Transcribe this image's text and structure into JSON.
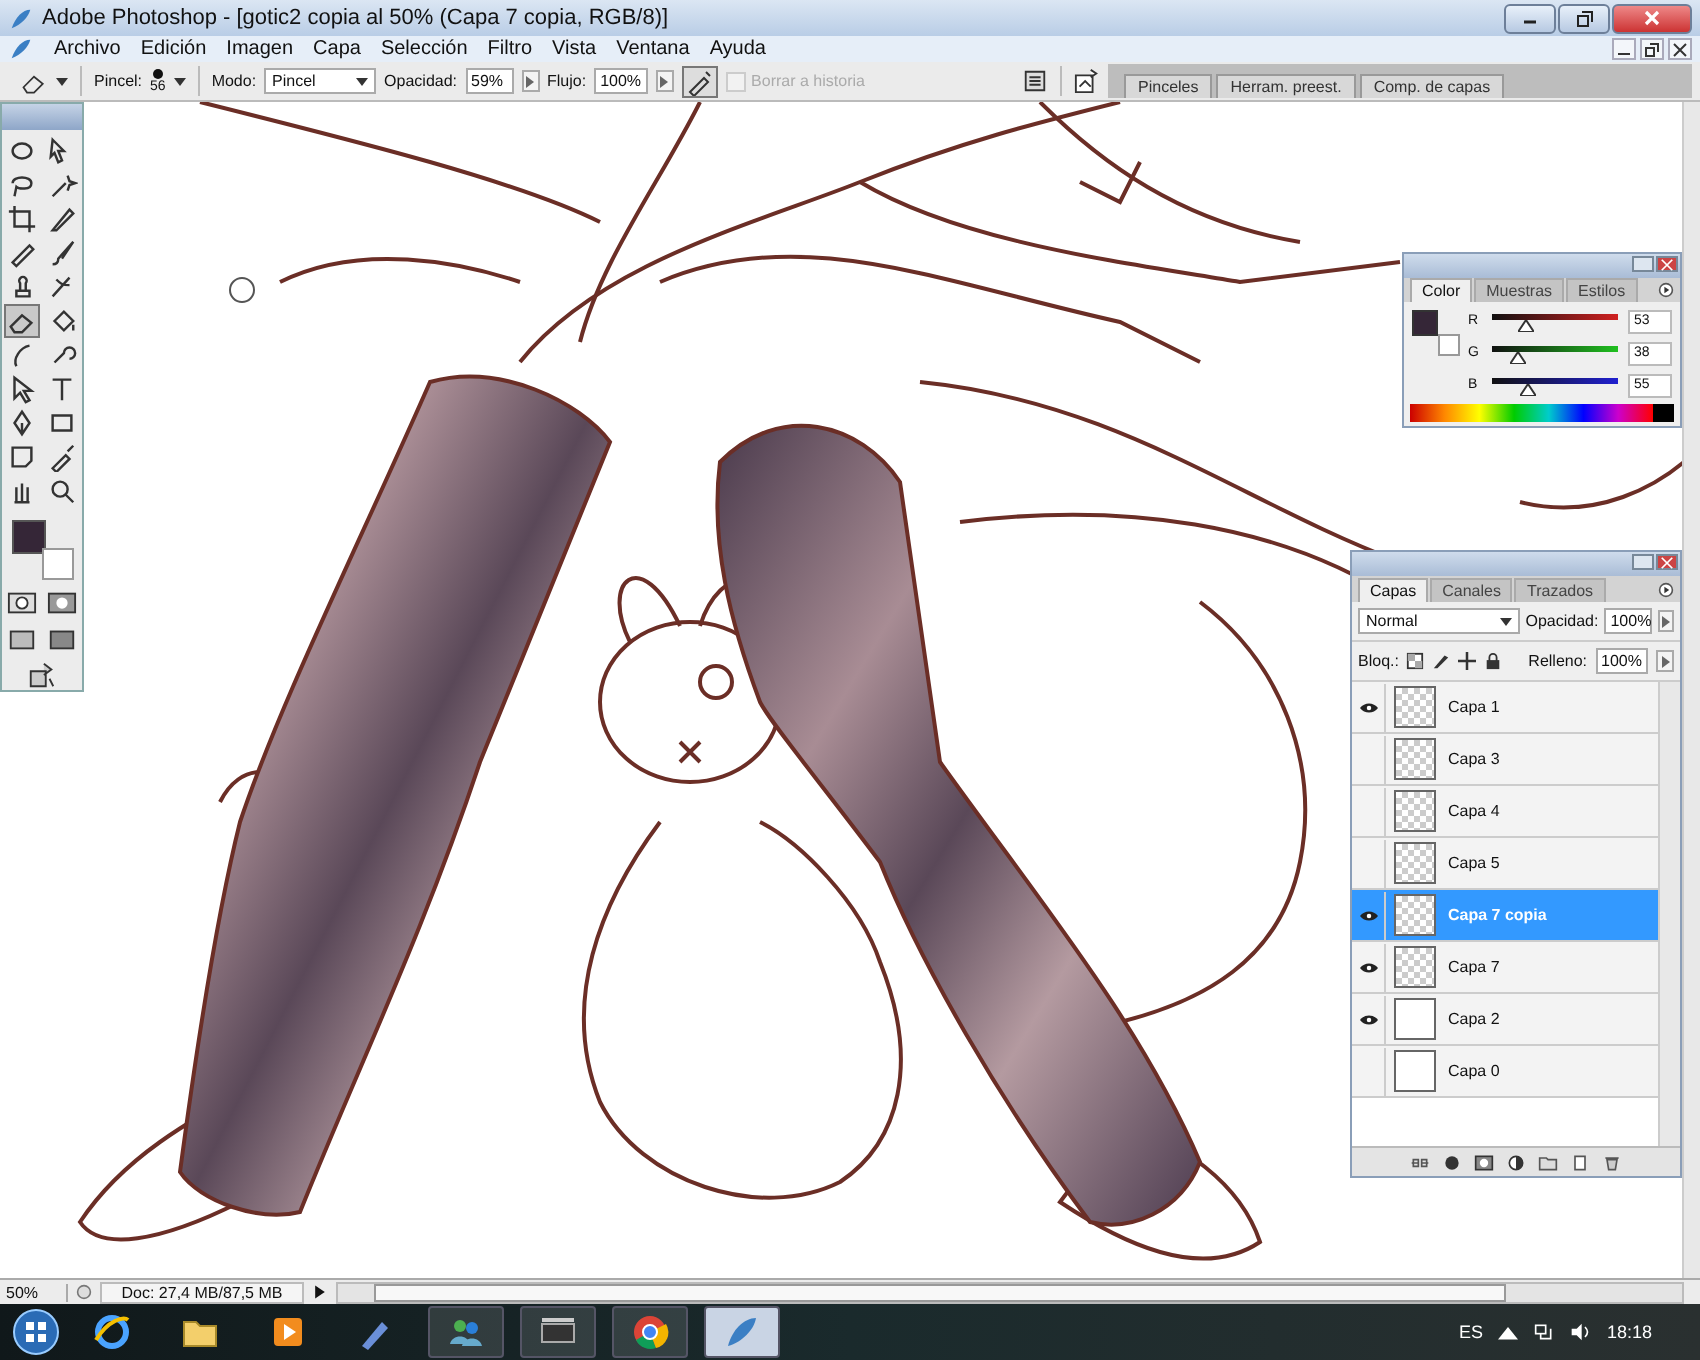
{
  "window": {
    "title": "Adobe Photoshop - [gotic2 copia al 50% (Capa 7 copia, RGB/8)]"
  },
  "menu": [
    "Archivo",
    "Edición",
    "Imagen",
    "Capa",
    "Selección",
    "Filtro",
    "Vista",
    "Ventana",
    "Ayuda"
  ],
  "options_bar": {
    "brush_label": "Pincel:",
    "brush_size": "56",
    "mode_label": "Modo:",
    "mode": "Pincel",
    "opacity_label": "Opacidad:",
    "opacity": "59%",
    "flow_label": "Flujo:",
    "flow": "100%",
    "erase_history": {
      "label": "Borrar a historia",
      "checked": false,
      "disabled": true
    }
  },
  "panel_well_tabs": [
    "Pinceles",
    "Herram. preest.",
    "Comp. de capas"
  ],
  "color_panel": {
    "tabs": [
      {
        "label": "Color",
        "selected": true
      },
      {
        "label": "Muestras",
        "selected": false
      },
      {
        "label": "Estilos",
        "selected": false
      }
    ],
    "channels": [
      {
        "name": "R",
        "value": "53",
        "level": 0.21
      },
      {
        "name": "G",
        "value": "38",
        "level": 0.15
      },
      {
        "name": "B",
        "value": "55",
        "level": 0.22
      }
    ]
  },
  "layers_panel": {
    "tabs": [
      {
        "label": "Capas",
        "selected": true
      },
      {
        "label": "Canales",
        "selected": false
      },
      {
        "label": "Trazados",
        "selected": false
      }
    ],
    "blend_mode": "Normal",
    "opacity_label": "Opacidad:",
    "opacity": "100%",
    "lock_label": "Bloq.:",
    "fill_label": "Relleno:",
    "fill": "100%",
    "layers": [
      {
        "name": "Capa 1",
        "visible": true,
        "selected": false,
        "kind": "transparent"
      },
      {
        "name": "Capa 3",
        "visible": false,
        "selected": false,
        "kind": "transparent"
      },
      {
        "name": "Capa 4",
        "visible": false,
        "selected": false,
        "kind": "transparent"
      },
      {
        "name": "Capa 5",
        "visible": false,
        "selected": false,
        "kind": "transparent"
      },
      {
        "name": "Capa 7 copia",
        "visible": true,
        "selected": true,
        "kind": "transparent"
      },
      {
        "name": "Capa 7",
        "visible": true,
        "selected": false,
        "kind": "transparent"
      },
      {
        "name": "Capa 2",
        "visible": true,
        "selected": false,
        "kind": "white"
      },
      {
        "name": "Capa 0",
        "visible": false,
        "selected": false,
        "kind": "white"
      }
    ]
  },
  "status_bar": {
    "zoom": "50%",
    "doc": "Doc: 27,4 MB/87,5 MB"
  },
  "taskbar": {
    "language": "ES",
    "clock": "18:18"
  }
}
